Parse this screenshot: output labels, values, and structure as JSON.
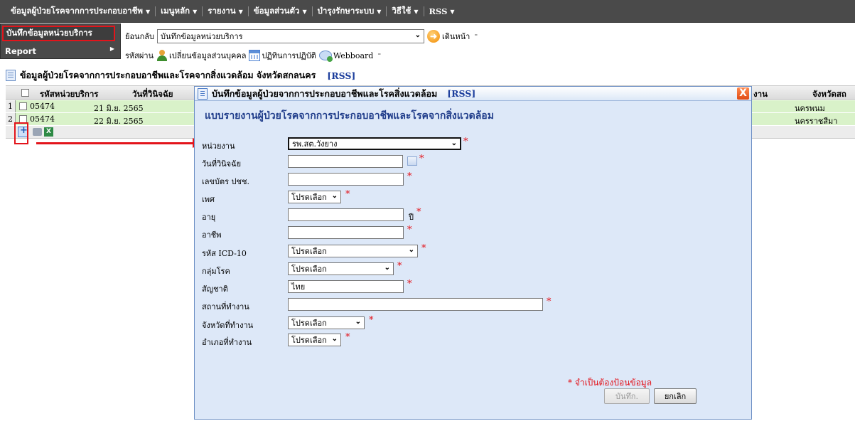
{
  "topmenu": {
    "items": [
      {
        "label": "ข้อมูลผู้ป่วยโรคจากการประกอบอาชีพ"
      },
      {
        "label": "เมนูหลัก"
      },
      {
        "label": "รายงาน"
      },
      {
        "label": "ข้อมูลส่วนตัว"
      },
      {
        "label": "บำรุงรักษาระบบ"
      },
      {
        "label": "วิธีใช้"
      },
      {
        "label": "RSS"
      }
    ]
  },
  "dropdown": {
    "selected_item": "บันทึกข้อมูลหน่วยบริการ",
    "report_item": "Report"
  },
  "toolbar": {
    "back_label": "ย้อนกลับ",
    "page_select_value": "บันทึกข้อมูลหน่วยบริการ",
    "go_label": "เดินหน้า",
    "password_label": "รหัสผ่าน",
    "change_personal_label": "เปลี่ยนข้อมูลส่วนบุคคล",
    "calendar_label": "ปฏิทินการปฏิบัติ",
    "webboard_label": "Webboard"
  },
  "list": {
    "title": "ข้อมูลผู้ป่วยโรคจากการประกอบอาชีพและโรคจากสิ่งแวดล้อม จังหวัดสกลนคร",
    "rss": "[RSS]",
    "headers": {
      "unit_code": "รหัสหน่วยบริการ",
      "diag_date": "วันที่วินิจฉัย",
      "work": "งาน",
      "province": "จังหวัดสถ"
    },
    "rows": [
      {
        "num": "1",
        "code": "05474",
        "date": "21 มิ.ย. 2565",
        "province": "นครพนม"
      },
      {
        "num": "2",
        "code": "05474",
        "date": "22 มิ.ย. 2565",
        "province": "นครราชสีมา"
      }
    ]
  },
  "modal": {
    "title": "บันทึกข้อมูลผู้ป่วยจากการประกอบอาชีพและโรคสิ่งแวดล้อม",
    "rss": "[RSS]",
    "close": "X",
    "subtitle": "แบบรายงานผู้ป่วยโรคจากการประกอบอาชีพและโรคจากสิ่งแวดล้อม",
    "fields": {
      "unit_label": "หน่วยงาน",
      "unit_value": "รพ.สต.วังยาง",
      "diag_date_label": "วันที่วินิจฉัย",
      "id_label": "เลขบัตร ปชช.",
      "sex_label": "เพศ",
      "sex_value": "โปรดเลือก",
      "age_label": "อายุ",
      "age_unit": "ปี",
      "occupation_label": "อาชีพ",
      "icd_label": "รหัส ICD-10",
      "icd_value": "โปรดเลือก",
      "group_label": "กลุ่มโรค",
      "group_value": "โปรดเลือก",
      "nationality_label": "สัญชาติ",
      "nationality_value": "ไทย",
      "workplace_label": "สถานที่ทำงาน",
      "work_province_label": "จังหวัดที่ทำงาน",
      "work_province_value": "โปรดเลือก",
      "work_district_label": "อำเภอที่ทำงาน",
      "work_district_value": "โปรดเลือก"
    },
    "required_star": "*",
    "required_note": "* จำเป็นต้องป้อนข้อมูล",
    "save_label": "บันทึก.",
    "cancel_label": "ยกเลิก"
  },
  "colors": {
    "menu_bg": "#4a4a4a",
    "highlight_red": "#e3141b",
    "row_green": "#d9f2c9",
    "modal_bg": "#dde8f8",
    "title_blue": "#1f3c8a"
  },
  "icons": [
    "chevron-down-icon",
    "go-forward-icon",
    "person-icon",
    "calendar-icon",
    "webboard-icon",
    "page-icon",
    "add-record-icon",
    "print-icon",
    "excel-icon",
    "close-icon",
    "date-picker-icon"
  ]
}
